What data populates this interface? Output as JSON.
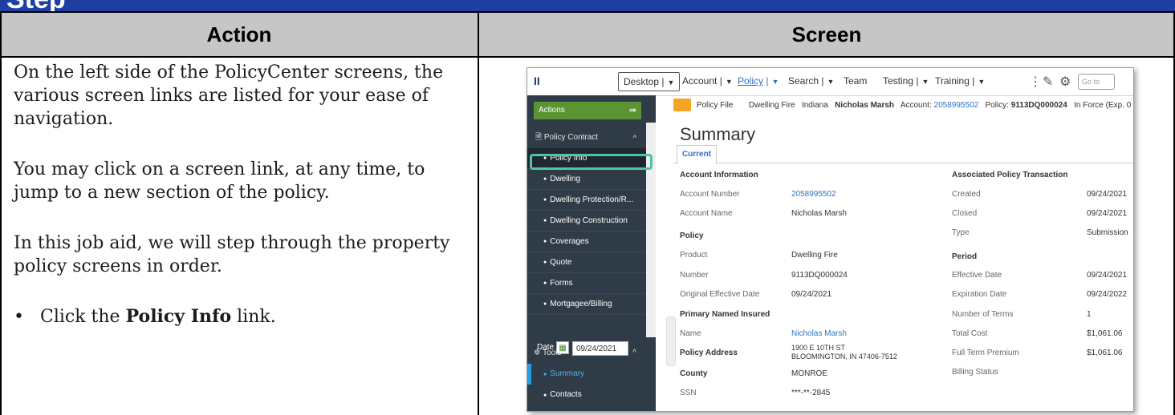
{
  "page": {
    "banner_title": "Step",
    "col_action": "Action",
    "col_screen": "Screen",
    "action": {
      "p1": "On the left side of the PolicyCenter screens, the various screen links are listed for your ease of navigation.",
      "p2": "You may click on a screen link, at any time, to jump to a new section of the policy.",
      "p3": "In this job aid, we will step through the property policy screens in order.",
      "bullet_pre": "Click the ",
      "bullet_bold": "Policy Info",
      "bullet_post": " link."
    }
  },
  "app": {
    "topnav": {
      "desktop": "Desktop",
      "account": "Account",
      "policy": "Policy",
      "search": "Search",
      "team": "Team",
      "testing": "Testing",
      "training": "Training",
      "goto_placeholder": "Go to"
    },
    "crumb": {
      "policy_file": "Policy File",
      "line": "Dwelling Fire",
      "state": "Indiana",
      "insured": "Nicholas Marsh",
      "account_label": "Account:",
      "account_no": "2058995502",
      "policy_label": "Policy:",
      "policy_no": "9113DQ000024",
      "status": "In Force (Exp. 0"
    },
    "sidebar": {
      "actions": "Actions",
      "section": "Policy Contract",
      "items": [
        "Policy Info",
        "Dwelling",
        "Dwelling Protection/R...",
        "Dwelling Construction",
        "Coverages",
        "Quote",
        "Forms",
        "Mortgagee/Billing"
      ],
      "date_label": "Date",
      "date_value": "09/24/2021",
      "tools": "Tools",
      "tool_items": [
        "Summary",
        "Contacts"
      ]
    },
    "main": {
      "title": "Summary",
      "tab": "Current",
      "account_info": "Account Information",
      "account_number_label": "Account Number",
      "account_number": "2058995502",
      "account_name_label": "Account Name",
      "account_name": "Nicholas Marsh",
      "policy_hdr": "Policy",
      "product_label": "Product",
      "product": "Dwelling Fire",
      "number_label": "Number",
      "number": "9113DQ000024",
      "orig_eff_label": "Original Effective Date",
      "orig_eff": "09/24/2021",
      "pni_hdr": "Primary Named Insured",
      "name_label": "Name",
      "name": "Nicholas Marsh",
      "addr_label": "Policy Address",
      "addr1": "1900 E 10TH ST",
      "addr2": "BLOOMINGTON, IN 47406-7512",
      "county_label": "County",
      "county": "MONROE",
      "ssn_label": "SSN",
      "ssn": "***-**-2845",
      "assoc_hdr": "Associated Policy Transaction",
      "created_label": "Created",
      "created": "09/24/2021",
      "closed_label": "Closed",
      "closed": "09/24/2021",
      "type_label": "Type",
      "type": "Submission",
      "period_hdr": "Period",
      "eff_label": "Effective Date",
      "eff": "09/24/2021",
      "exp_label": "Expiration Date",
      "exp": "09/24/2022",
      "terms_label": "Number of Terms",
      "terms": "1",
      "total_cost_label": "Total Cost",
      "total_cost": "$1,061.06",
      "ftp_label": "Full Term Premium",
      "ftp": "$1,061.06",
      "billing_label": "Billing Status"
    }
  }
}
